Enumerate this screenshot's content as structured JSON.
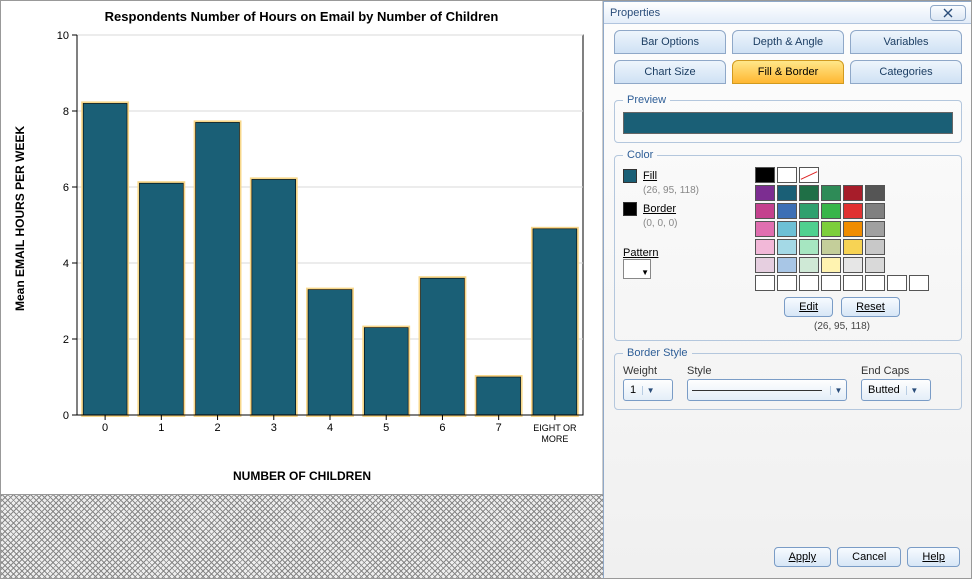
{
  "chart_data": {
    "type": "bar",
    "title": "Respondents Number of Hours on Email by Number of Children",
    "xlabel": "NUMBER OF CHILDREN",
    "ylabel": "Mean EMAIL HOURS PER WEEK",
    "categories": [
      "0",
      "1",
      "2",
      "3",
      "4",
      "5",
      "6",
      "7",
      "EIGHT OR MORE"
    ],
    "values": [
      8.2,
      6.1,
      7.7,
      6.2,
      3.3,
      2.3,
      3.6,
      1.0,
      4.9
    ],
    "ylim": [
      0,
      10
    ]
  },
  "dialog": {
    "title": "Properties",
    "tabs_row1": [
      "Bar Options",
      "Depth & Angle",
      "Variables"
    ],
    "tabs_row2": [
      "Chart Size",
      "Fill & Border",
      "Categories"
    ],
    "selected_tab": "Fill & Border",
    "preview_label": "Preview",
    "preview_color": "#1a5f76",
    "color": {
      "group_label": "Color",
      "fill_label": "Fill",
      "fill_rgb": "(26, 95, 118)",
      "fill_hex": "#1a5f76",
      "border_label": "Border",
      "border_rgb": "(0, 0, 0)",
      "border_hex": "#000000",
      "pattern_label": "Pattern",
      "palette": [
        "#000000",
        "#ffffff",
        "reset",
        "",
        "",
        "",
        "",
        "",
        "#7c2d91",
        "#1a5f76",
        "#1f6f46",
        "#2e8b57",
        "#a71d2a",
        "#555555",
        "",
        "",
        "#c4418e",
        "#3d6fb5",
        "#2fa06e",
        "#38b54a",
        "#e03131",
        "#808080",
        "",
        "",
        "#e06fb0",
        "#6dc0d5",
        "#4fd08f",
        "#7cce3b",
        "#f08c00",
        "#a0a0a0",
        "",
        "",
        "#f2b8d8",
        "#a4d9e6",
        "#a6e6c1",
        "#c4ce9a",
        "#f7d354",
        "#c8c8c8",
        "",
        "",
        "#e6cfe0",
        "#a8c6e6",
        "#cfe9d6",
        "#fff3b0",
        "#e6e6e6",
        "#d9d9d9",
        "",
        "",
        "#ffffff",
        "#ffffff",
        "#ffffff",
        "#ffffff",
        "#ffffff",
        "#ffffff",
        "#ffffff",
        "#ffffff"
      ],
      "edit_label": "Edit",
      "reset_label": "Reset",
      "rgb_display": "(26, 95, 118)"
    },
    "border_style": {
      "group_label": "Border Style",
      "weight_label": "Weight",
      "weight_value": "1",
      "style_label": "Style",
      "endcaps_label": "End Caps",
      "endcaps_value": "Butted"
    },
    "footer": {
      "apply": "Apply",
      "cancel": "Cancel",
      "help": "Help"
    },
    "close_aria": "Close"
  }
}
